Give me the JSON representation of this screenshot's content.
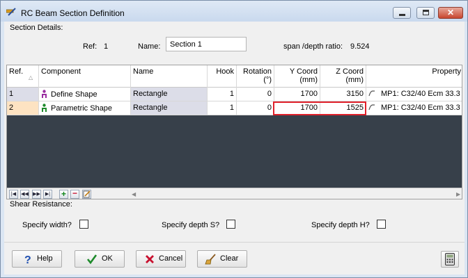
{
  "window": {
    "title": "RC Beam Section Definition",
    "controls": {
      "minimize": "minimize",
      "maximize": "maximize",
      "close": "✕"
    }
  },
  "details": {
    "section_label": "Section Details:",
    "ref_label": "Ref:",
    "ref_value": "1",
    "name_label": "Name:",
    "name_value": "Section 1",
    "span_label": "span /depth ratio:",
    "span_value": "9.524"
  },
  "grid": {
    "headers": {
      "ref": "Ref.",
      "component": "Component",
      "name": "Name",
      "hook": "Hook",
      "rotation": "Rotation\n(°)",
      "ycoord": "Y Coord\n(mm)",
      "zcoord": "Z Coord\n(mm)",
      "property": "Property"
    },
    "rows": [
      {
        "ref": "1",
        "component": "Define Shape",
        "component_icon": "purple-person-icon",
        "name": "Rectangle",
        "hook": "1",
        "rotation": "0",
        "ycoord": "1700",
        "zcoord": "3150",
        "property": "MP1: C32/40 Ecm 33.3"
      },
      {
        "ref": "2",
        "component": "Parametric Shape",
        "component_icon": "green-person-icon",
        "name": "Rectangle",
        "hook": "1",
        "rotation": "0",
        "ycoord": "1700",
        "zcoord": "1525",
        "property": "MP1: C32/40 Ecm 33.3"
      }
    ],
    "nav_icons": [
      "first-icon",
      "prev-icon",
      "next-icon",
      "last-icon",
      "add-row-icon",
      "delete-row-icon",
      "edit-icon"
    ]
  },
  "shear": {
    "label": "Shear Resistance:",
    "width_label": "Specify width?",
    "depth_s_label": "Specify depth S?",
    "depth_h_label": "Specify depth H?",
    "width_checked": false,
    "depth_s_checked": false,
    "depth_h_checked": false
  },
  "buttons": {
    "help": "Help",
    "ok": "OK",
    "cancel": "Cancel",
    "clear": "Clear"
  },
  "colors": {
    "highlight": "#e0202a",
    "grid_background": "#37404a",
    "selected_ref": "#fde3c2"
  }
}
